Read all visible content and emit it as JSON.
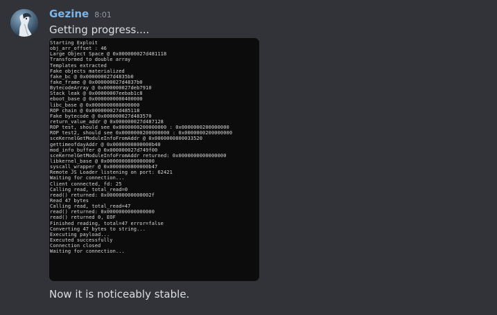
{
  "message": {
    "author": "Gezine",
    "timestamp": "8:01",
    "text_before": "Getting progress....",
    "text_after": "Now it is noticeably stable."
  },
  "attachment": {
    "console_lines": [
      "Starting Exploit",
      "obj_arr_offset : 46",
      "Large Object Space @ 0x000000027d481118",
      "Transformed to double array",
      "Templates extracted",
      "Fake objects materialized",
      "fake_bc @ 0x000000027d4835b0",
      "fake_frame @ 0x000000027d4837b0",
      "BytecodeArray @ 0x000000027deb7910",
      "Stack leak @ 0x00000007eebab1c8",
      "eboot_base @ 0x0000000000400000",
      "libc_base @ 0x0000000080000000",
      "ROP chain @ 0x000000027d485118",
      "Fake bytecode @ 0x000000027d483570",
      "return_value_addr @ 0x000000027d487128",
      "ROP test, should see 0x0000000200000000 : 0x0000000200000000",
      "ROP test2, should see 0x0000000200000000 : 0x0000000200000000",
      "sceKernelGetModuleInfoFromAddr @ 0x0000000800033520",
      "gettimeofdayAddr @ 0x0000000800000b40",
      "mod_info buffer @ 0x000000027d749f00",
      "sceKernelGetModuleInfoFromAddr returned: 0x0000000000000000",
      "libkernel_base @ 0x0000000800000000",
      "syscall_wrapper @ 0x0000000800000b47",
      "Remote JS Loader listening on port: 62421",
      "Waiting for connection...",
      "Client connected, fd: 25",
      "Calling read, total_read=0",
      "read() returned: 0x000000000000002f",
      "Read 47 bytes",
      "Calling read, total_read=47",
      "read() returned: 0x0000000000000000",
      "read() returned 0, EOF",
      "Finished reading, total=47 error=false",
      "Converting 47 bytes to string...",
      "Executing payload...",
      "Executed successfully",
      "Connection closed",
      "Waiting for connection..."
    ]
  },
  "colors": {
    "background": "#313338",
    "username": "#7ab6e8",
    "timestamp": "#949ba4",
    "message_text": "#dbdee1",
    "console_background": "#0c0c0c",
    "console_text": "#d8d8d8"
  },
  "icons": {
    "avatar": "user-avatar"
  }
}
